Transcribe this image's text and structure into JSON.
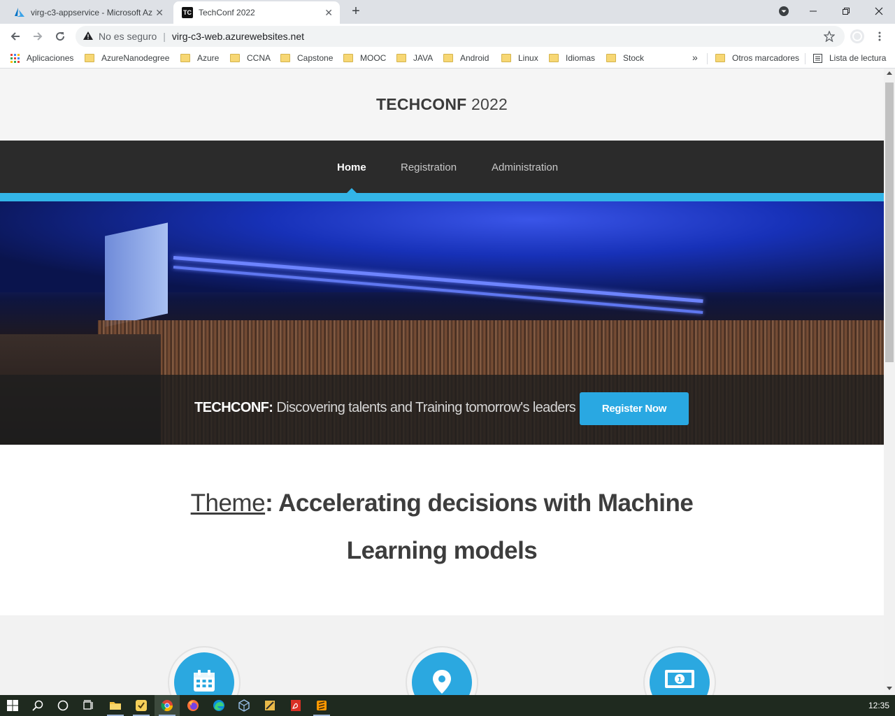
{
  "browser": {
    "tabs": [
      {
        "title": "virg-c3-appservice - Microsoft Az",
        "active": false,
        "icon": "azure-icon"
      },
      {
        "title": "TechConf 2022",
        "active": true,
        "icon": "techconf-icon",
        "icon_text": "TC"
      }
    ],
    "new_tab_label": "+",
    "omnibox": {
      "security_text": "No es seguro",
      "url": "virg-c3-web.azurewebsites.net"
    },
    "bookmarks": {
      "apps_label": "Aplicaciones",
      "items": [
        "AzureNanodegree",
        "Azure",
        "CCNA",
        "Capstone",
        "MOOC",
        "JAVA",
        "Android",
        "Linux",
        "Idiomas",
        "Stock"
      ],
      "overflow_label": "»",
      "other_label": "Otros marcadores",
      "reading_list_label": "Lista de lectura"
    }
  },
  "site": {
    "brand_bold": "TECHCONF",
    "brand_year": " 2022",
    "nav": [
      {
        "label": "Home",
        "active": true
      },
      {
        "label": "Registration",
        "active": false
      },
      {
        "label": "Administration",
        "active": false
      }
    ],
    "hero": {
      "tagline_bold": "TECHCONF:",
      "tagline_rest": " Discovering talents and Training tomorrow's leaders",
      "cta": "Register Now"
    },
    "theme": {
      "label": "Theme",
      "text": ": Accelerating decisions with Machine Learning models"
    },
    "features": [
      "calendar-icon",
      "location-pin-icon",
      "money-icon"
    ]
  },
  "taskbar": {
    "clock": "12:35"
  },
  "colors": {
    "accent": "#2ba8e0",
    "nav_bg": "#2b2b2b",
    "header_bg": "#f5f5f5"
  }
}
